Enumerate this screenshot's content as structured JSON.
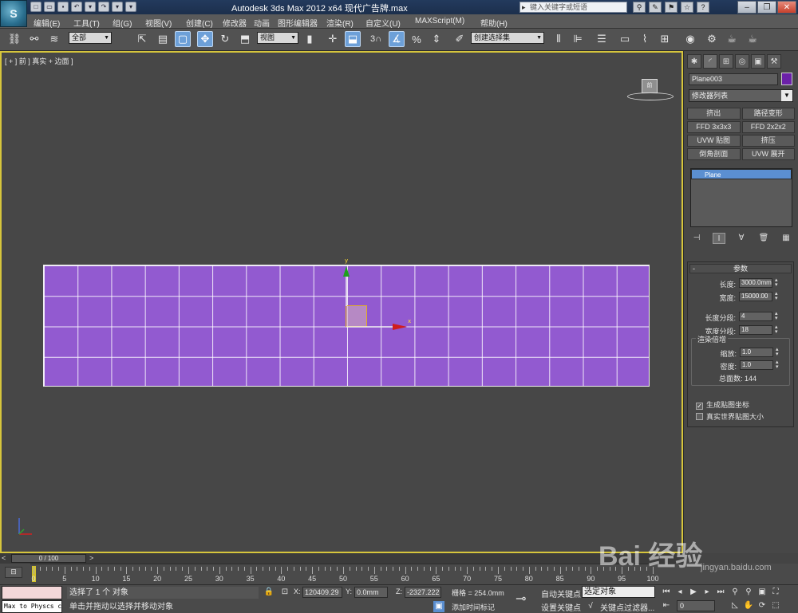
{
  "app": {
    "title": "Autodesk 3ds Max  2012 x64      现代广告牌.max",
    "logo_letter": "S",
    "help_search_placeholder": "键入关键字或短语"
  },
  "menu": [
    "编辑(E)",
    "工具(T)",
    "组(G)",
    "视图(V)",
    "创建(C)",
    "修改器",
    "动画",
    "图形编辑器",
    "渲染(R)",
    "自定义(U)",
    "MAXScript(M)",
    "帮助(H)"
  ],
  "toolbar": {
    "selection_filter": "全部",
    "reference_coord": "视图",
    "snap_label": "3",
    "named_selection": "创建选择集"
  },
  "viewport": {
    "label": "[ + ] 前 ] 真实 + 边面 ]",
    "viewcube_face": "前",
    "gizmo_y": "y",
    "gizmo_x": "x",
    "plane_color": "#925ad0",
    "border_color": "#d6c53c",
    "plane_grid": {
      "rows": 4,
      "cols": 18
    }
  },
  "command_panel": {
    "object_name": "Plane003",
    "object_color": "#6b21a8",
    "modifier_list": "修改器列表",
    "modifier_buttons": [
      "挤出",
      "路径变形",
      "FFD 3x3x3",
      "FFD 2x2x2",
      "UVW 贴图",
      "挤压",
      "倒角剖面",
      "UVW 展开"
    ],
    "stack_item": "Plane",
    "rollout_title": "参数",
    "params": {
      "length_label": "长度:",
      "length_value": "3000.0mm",
      "width_label": "宽度:",
      "width_value": "15000.00",
      "length_segs_label": "长度分段:",
      "length_segs_value": "4",
      "width_segs_label": "宽度分段:",
      "width_segs_value": "18",
      "render_group_label": "渲染倍增",
      "scale_label": "缩放:",
      "scale_value": "1.0",
      "density_label": "密度:",
      "density_value": "1.0",
      "total_faces_label": "总面数: 144",
      "gen_mapping_label": "生成贴图坐标",
      "real_world_label": "真实世界贴图大小"
    }
  },
  "time": {
    "slider_label": "0 / 100",
    "ruler_ticks": [
      "0",
      "5",
      "10",
      "15",
      "20",
      "25",
      "30",
      "35",
      "40",
      "45",
      "50",
      "55",
      "60",
      "65",
      "70",
      "75",
      "80",
      "85",
      "90",
      "95",
      "100"
    ]
  },
  "status": {
    "maxscript_text": "Max to Physcs c",
    "line1": "选择了 1 个 对象",
    "line2": "单击并拖动以选择并移动对象",
    "x_label": "X:",
    "x_value": "120409.29",
    "y_label": "Y:",
    "y_value": "0.0mm",
    "z_label": "Z:",
    "z_value": "-2327.222",
    "grid": "栅格 = 254.0mm",
    "add_time_tag": "添加时间标记",
    "auto_key": "自动关键点",
    "set_key": "设置关键点",
    "selected_dropdown": "选定对象",
    "key_filters": "关键点过滤器...",
    "frame": "0"
  },
  "watermark": {
    "text": "Bai  经验",
    "sub": "jingyan.baidu.com"
  }
}
